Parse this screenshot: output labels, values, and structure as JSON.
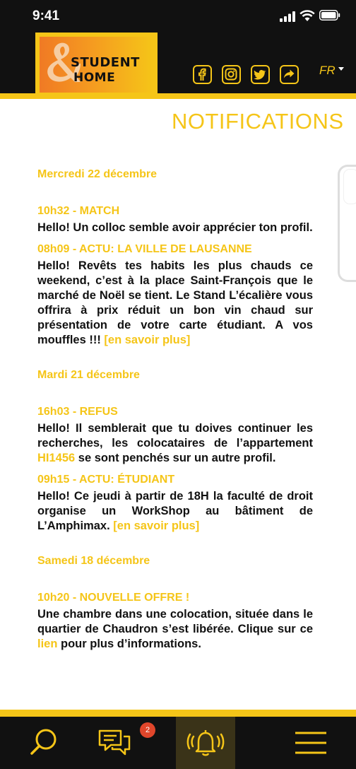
{
  "status_bar": {
    "time": "9:41"
  },
  "header": {
    "logo": {
      "line1": "STUDENT",
      "line2": "HOME"
    },
    "social_icons": [
      "facebook-icon",
      "instagram-icon",
      "twitter-icon",
      "share-icon"
    ],
    "language": "FR"
  },
  "page": {
    "title": "NOTIFICATIONS"
  },
  "notifications": [
    {
      "date": "Mercredi 22 décembre",
      "items": [
        {
          "title": "10h32 - MATCH",
          "text": "Hello! Un colloc semble avoir apprécier ton profil."
        },
        {
          "title": "08h09 - ACTU: LA VILLE DE LAUSANNE",
          "text": "Hello! Revêts tes habits les plus chauds ce weekend, c’est à la place Saint-François que le marché de Noël se tient. Le Stand L’écalière vous offrira à prix réduit un bon vin chaud sur présentation de votre carte étudiant. A vos mouffles !!! ",
          "link": "[en savoir plus]"
        }
      ]
    },
    {
      "date": "Mardi 21 décembre",
      "items": [
        {
          "title": "16h03  - REFUS",
          "text_before": "Hello! Il semblerait que tu doives continuer les recherches, les colocataires de l’appartement ",
          "link": "HI1456",
          "text_after": " se sont penchés sur un autre profil."
        },
        {
          "title": "09h15  - ACTU: ÉTUDIANT",
          "text": "Hello! Ce jeudi à partir de 18H la faculté de droit organise un WorkShop au bâtiment de L’Amphimax. ",
          "link": "[en savoir plus]"
        }
      ]
    },
    {
      "date": "Samedi 18 décembre",
      "items": [
        {
          "title": "10h20  - NOUVELLE OFFRE !",
          "text_before": "Une chambre dans une colocation, située dans le quartier de Chaudron s’est libérée. Clique sur ce ",
          "link": "lien",
          "text_after": " pour plus d’informations."
        }
      ]
    }
  ],
  "tabbar": {
    "tabs": [
      "search-icon",
      "messages-icon",
      "notifications-bell-icon",
      "menu-icon"
    ],
    "active": "notifications-bell-icon",
    "messages_badge": "2"
  },
  "colors": {
    "accent": "#F5C518",
    "dark": "#111111",
    "badge": "#E0462B",
    "logo_orange": "#F07A24"
  }
}
